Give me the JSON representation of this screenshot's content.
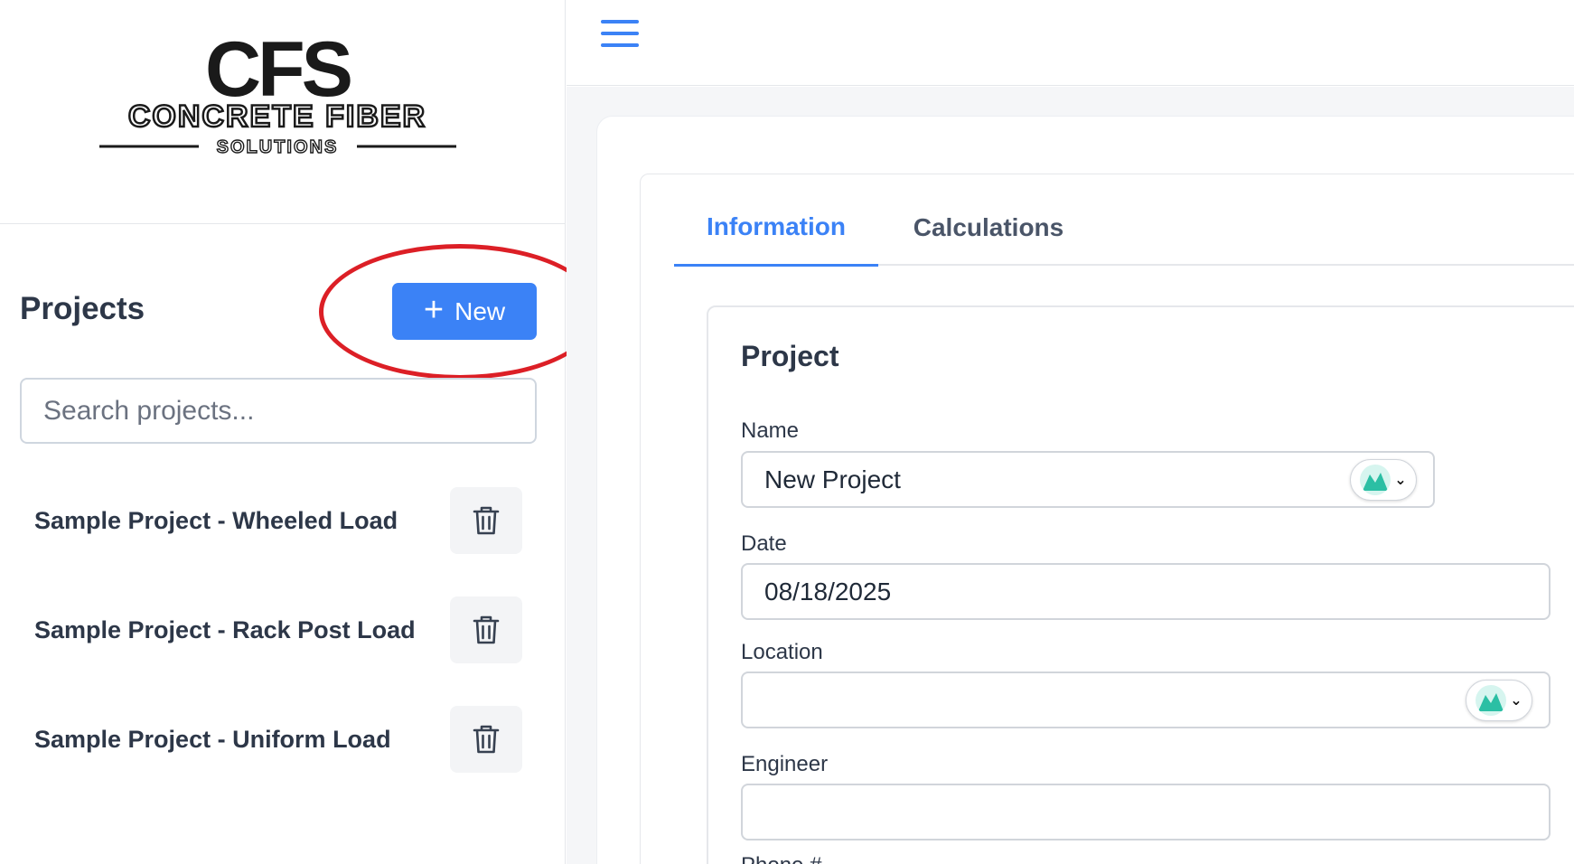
{
  "logo": {
    "initials": "CFS",
    "company_line1": "CONCRETE FIBER",
    "company_line2": "SOLUTIONS"
  },
  "sidebar": {
    "title": "Projects",
    "new_button_label": "New",
    "search_placeholder": "Search projects...",
    "projects": [
      {
        "name": "Sample Project - Wheeled Load"
      },
      {
        "name": "Sample Project - Rack Post Load"
      },
      {
        "name": "Sample Project - Uniform Load"
      }
    ]
  },
  "main": {
    "tabs": [
      {
        "label": "Information",
        "active": true
      },
      {
        "label": "Calculations",
        "active": false
      }
    ],
    "card_title": "Project",
    "fields": {
      "name": {
        "label": "Name",
        "value": "New Project"
      },
      "date": {
        "label": "Date",
        "value": "08/18/2025"
      },
      "location": {
        "label": "Location",
        "value": ""
      },
      "engineer": {
        "label": "Engineer",
        "value": ""
      },
      "phone": {
        "label": "Phone #"
      }
    }
  },
  "colors": {
    "accent": "#3b82f6",
    "annotation": "#dc1f26",
    "extension": "#2bbfa4"
  },
  "icons": [
    "hamburger-menu-icon",
    "plus-icon",
    "trash-icon",
    "extension-logo-icon",
    "chevron-down-icon"
  ]
}
